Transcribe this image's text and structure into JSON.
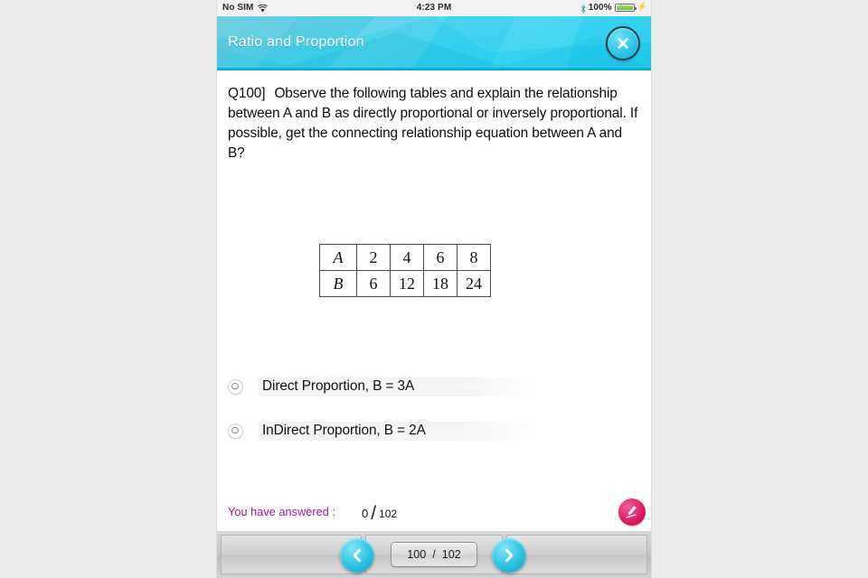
{
  "status_bar": {
    "carrier": "No SIM",
    "wifi_icon": "wifi-icon",
    "time": "4:23 PM",
    "bluetooth_icon": "bluetooth-icon",
    "battery_percent": "100%",
    "battery_icon": "battery-icon",
    "charging_icon": "charging-bolt-icon"
  },
  "header": {
    "title": "Ratio and Proportion",
    "close_icon": "close-icon",
    "accent_color": "#19cdf0"
  },
  "question": {
    "number": "Q100]",
    "text": "Observe the following tables and explain the relationship between A and B as directly proportional or inversely proportional. If possible, get the connecting relationship equation between A and B?"
  },
  "table": {
    "rows": [
      {
        "label": "A",
        "values": [
          "2",
          "4",
          "6",
          "8"
        ]
      },
      {
        "label": "B",
        "values": [
          "6",
          "12",
          "18",
          "24"
        ]
      }
    ]
  },
  "options": [
    {
      "label": "Direct Proportion, B = 3A",
      "selected": false
    },
    {
      "label": "InDirect Proportion, B = 2A",
      "selected": false
    }
  ],
  "answered": {
    "label": "You have answered :",
    "count": "0",
    "separator": "/",
    "total": "102",
    "label_color": "#9b1b9b",
    "pen_icon": "pen-icon"
  },
  "nav": {
    "prev_icon": "chevron-left-icon",
    "next_icon": "chevron-right-icon",
    "page_current": "100",
    "page_separator": "/",
    "page_total": "102"
  }
}
